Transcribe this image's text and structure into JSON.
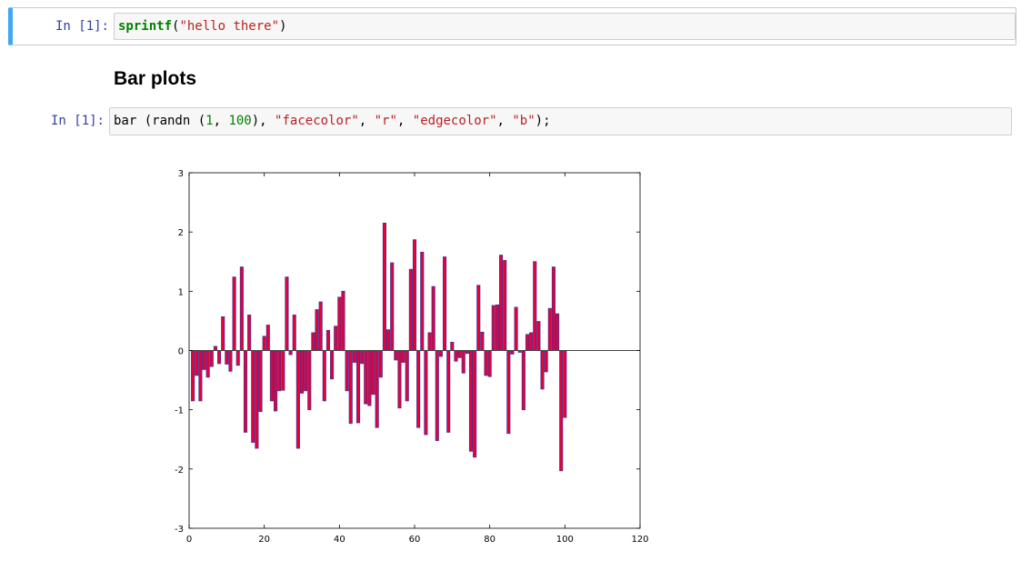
{
  "cells": [
    {
      "prompt": "In [1]:",
      "code": {
        "fn": "sprintf",
        "open": "(",
        "str": "\"hello there\"",
        "close": ")"
      }
    },
    {
      "heading": "Bar plots"
    },
    {
      "prompt": "In [1]:",
      "code": {
        "t1": "bar (randn (",
        "n1": "1",
        "t2": ", ",
        "n2": "100",
        "t3": "), ",
        "s1": "\"facecolor\"",
        "t4": ", ",
        "s2": "\"r\"",
        "t5": ", ",
        "s3": "\"edgecolor\"",
        "t6": ", ",
        "s4": "\"b\"",
        "t7": ");"
      }
    }
  ],
  "colors": {
    "accent": "#42a5f5",
    "prompt": "#303f9f",
    "bar_face": "#e8003a",
    "bar_edge": "#4b2f8f"
  },
  "chart_data": {
    "type": "bar",
    "x": [
      1,
      2,
      3,
      4,
      5,
      6,
      7,
      8,
      9,
      10,
      11,
      12,
      13,
      14,
      15,
      16,
      17,
      18,
      19,
      20,
      21,
      22,
      23,
      24,
      25,
      26,
      27,
      28,
      29,
      30,
      31,
      32,
      33,
      34,
      35,
      36,
      37,
      38,
      39,
      40,
      41,
      42,
      43,
      44,
      45,
      46,
      47,
      48,
      49,
      50,
      51,
      52,
      53,
      54,
      55,
      56,
      57,
      58,
      59,
      60,
      61,
      62,
      63,
      64,
      65,
      66,
      67,
      68,
      69,
      70,
      71,
      72,
      73,
      74,
      75,
      76,
      77,
      78,
      79,
      80,
      81,
      82,
      83,
      84,
      85,
      86,
      87,
      88,
      89,
      90,
      91,
      92,
      93,
      94,
      95,
      96,
      97,
      98,
      99,
      100
    ],
    "values": [
      -0.85,
      -0.42,
      -0.85,
      -0.32,
      -0.45,
      -0.27,
      0.07,
      -0.22,
      0.57,
      -0.23,
      -0.35,
      1.24,
      -0.25,
      1.41,
      -1.38,
      0.6,
      -1.55,
      -1.65,
      -1.03,
      0.24,
      0.43,
      -0.85,
      -1.02,
      -0.68,
      -0.67,
      1.24,
      -0.07,
      0.6,
      -1.65,
      -0.72,
      -0.68,
      -1.0,
      0.3,
      0.69,
      0.82,
      -0.85,
      0.34,
      -0.48,
      0.41,
      0.9,
      1.0,
      -0.68,
      -1.23,
      -0.2,
      -1.22,
      -0.22,
      -0.9,
      -0.93,
      -0.74,
      -1.3,
      -0.45,
      2.15,
      0.35,
      1.48,
      -0.16,
      -0.97,
      -0.2,
      -0.85,
      1.37,
      1.87,
      -1.3,
      1.66,
      -1.42,
      0.3,
      1.08,
      -1.52,
      -0.1,
      1.58,
      -1.38,
      0.14,
      -0.18,
      -0.12,
      -0.38,
      -0.05,
      -1.7,
      -1.8,
      1.1,
      0.31,
      -0.42,
      -0.44,
      0.76,
      0.77,
      1.61,
      1.52,
      -1.4,
      -0.06,
      0.73,
      -0.03,
      -1.0,
      0.27,
      0.3,
      1.5,
      0.49,
      -0.65,
      -0.36,
      0.71,
      1.41,
      0.62,
      -2.03,
      -1.13
    ],
    "xlim": [
      0,
      120
    ],
    "ylim": [
      -3,
      3
    ],
    "xticks": [
      0,
      20,
      40,
      60,
      80,
      100,
      120
    ],
    "yticks": [
      -3,
      -2,
      -1,
      0,
      1,
      2,
      3
    ],
    "xtick_labels": [
      "0",
      "20",
      "40",
      "60",
      "80",
      "100",
      "120"
    ],
    "ytick_labels": [
      "-3",
      "-2",
      "-1",
      "0",
      "1",
      "2",
      "3"
    ],
    "facecolor": "r",
    "edgecolor": "b",
    "title": "",
    "xlabel": "",
    "ylabel": "",
    "grid": false
  }
}
